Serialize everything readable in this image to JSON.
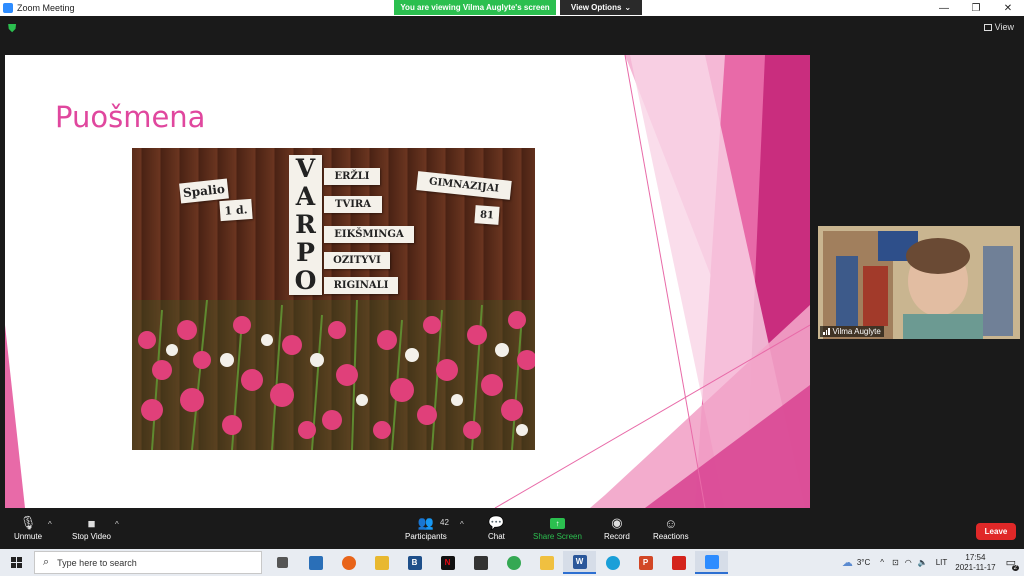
{
  "window": {
    "title": "Zoom Meeting",
    "minimize": "—",
    "restore": "❐",
    "close": "✕"
  },
  "banner": {
    "viewing": "You are viewing Vilma Auglyte's screen",
    "view_options": "View Options",
    "view": "View"
  },
  "slide": {
    "title": "Puošmena",
    "photo": {
      "card_spalio": "Spalio",
      "card_1d": "1 d.",
      "letters": [
        "V",
        "A",
        "R",
        "P",
        "O"
      ],
      "words": [
        "ERŽLI",
        "TVIRA",
        "EIKŠMINGA",
        "OZITYVI",
        "RIGINALI"
      ],
      "card_gimnazijai": "GIMNAZIJAI",
      "card_81": "81"
    }
  },
  "participant": {
    "name": "Vilma Auglyte"
  },
  "toolbar": {
    "unmute": "Unmute",
    "stop_video": "Stop Video",
    "participants": "Participants",
    "participants_count": "42",
    "chat": "Chat",
    "share_screen": "Share Screen",
    "record": "Record",
    "reactions": "Reactions",
    "leave": "Leave"
  },
  "taskbar": {
    "search_placeholder": "Type here to search",
    "weather": "3°C",
    "language": "LIT",
    "time": "17:54",
    "date": "2021-11-17",
    "notifications": "2"
  },
  "colors": {
    "accent_green": "#2bbf4f",
    "leave_red": "#e02828",
    "slide_pink": "#e0479e"
  }
}
